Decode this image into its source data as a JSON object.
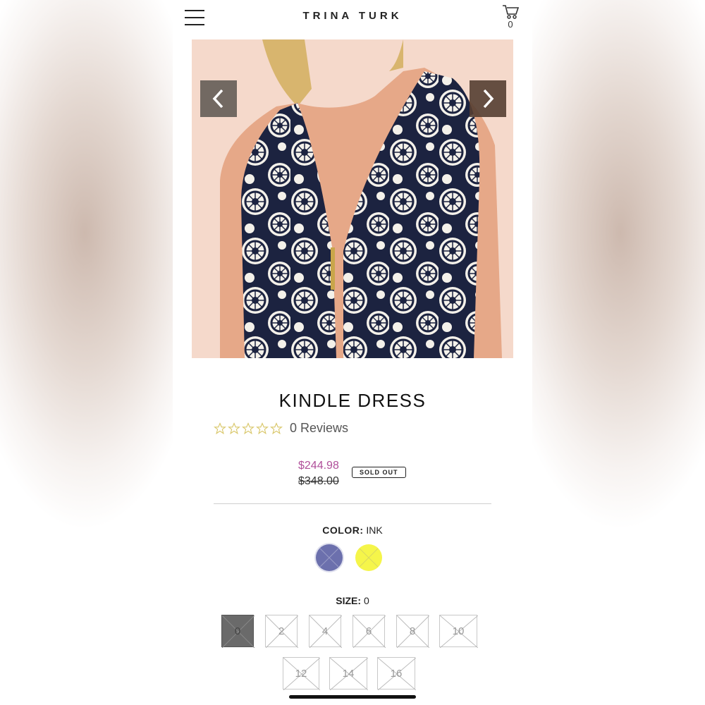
{
  "header": {
    "brand": "TRINA TURK",
    "cart_count": "0",
    "menu_icon": "hamburger-icon",
    "cart_icon": "cart-icon"
  },
  "gallery": {
    "prev_icon": "chevron-left-icon",
    "next_icon": "chevron-right-icon"
  },
  "product": {
    "title": "KINDLE DRESS",
    "rating_stars": 0,
    "reviews": "0 Reviews",
    "sale_price": "$244.98",
    "original_price": "$348.00",
    "badge": "SOLD OUT"
  },
  "color": {
    "label": "COLOR:",
    "selected": "INK",
    "swatches": [
      {
        "name": "ink",
        "color": "#6c70ad"
      },
      {
        "name": "yellow",
        "color": "#f5f54a"
      }
    ]
  },
  "size": {
    "label": "SIZE:",
    "selected": "0",
    "options": [
      "0",
      "2",
      "4",
      "6",
      "8",
      "10",
      "12",
      "14",
      "16"
    ]
  },
  "colors": {
    "accent_sale": "#b0509a",
    "text": "#111111",
    "star": "#e0d070"
  }
}
